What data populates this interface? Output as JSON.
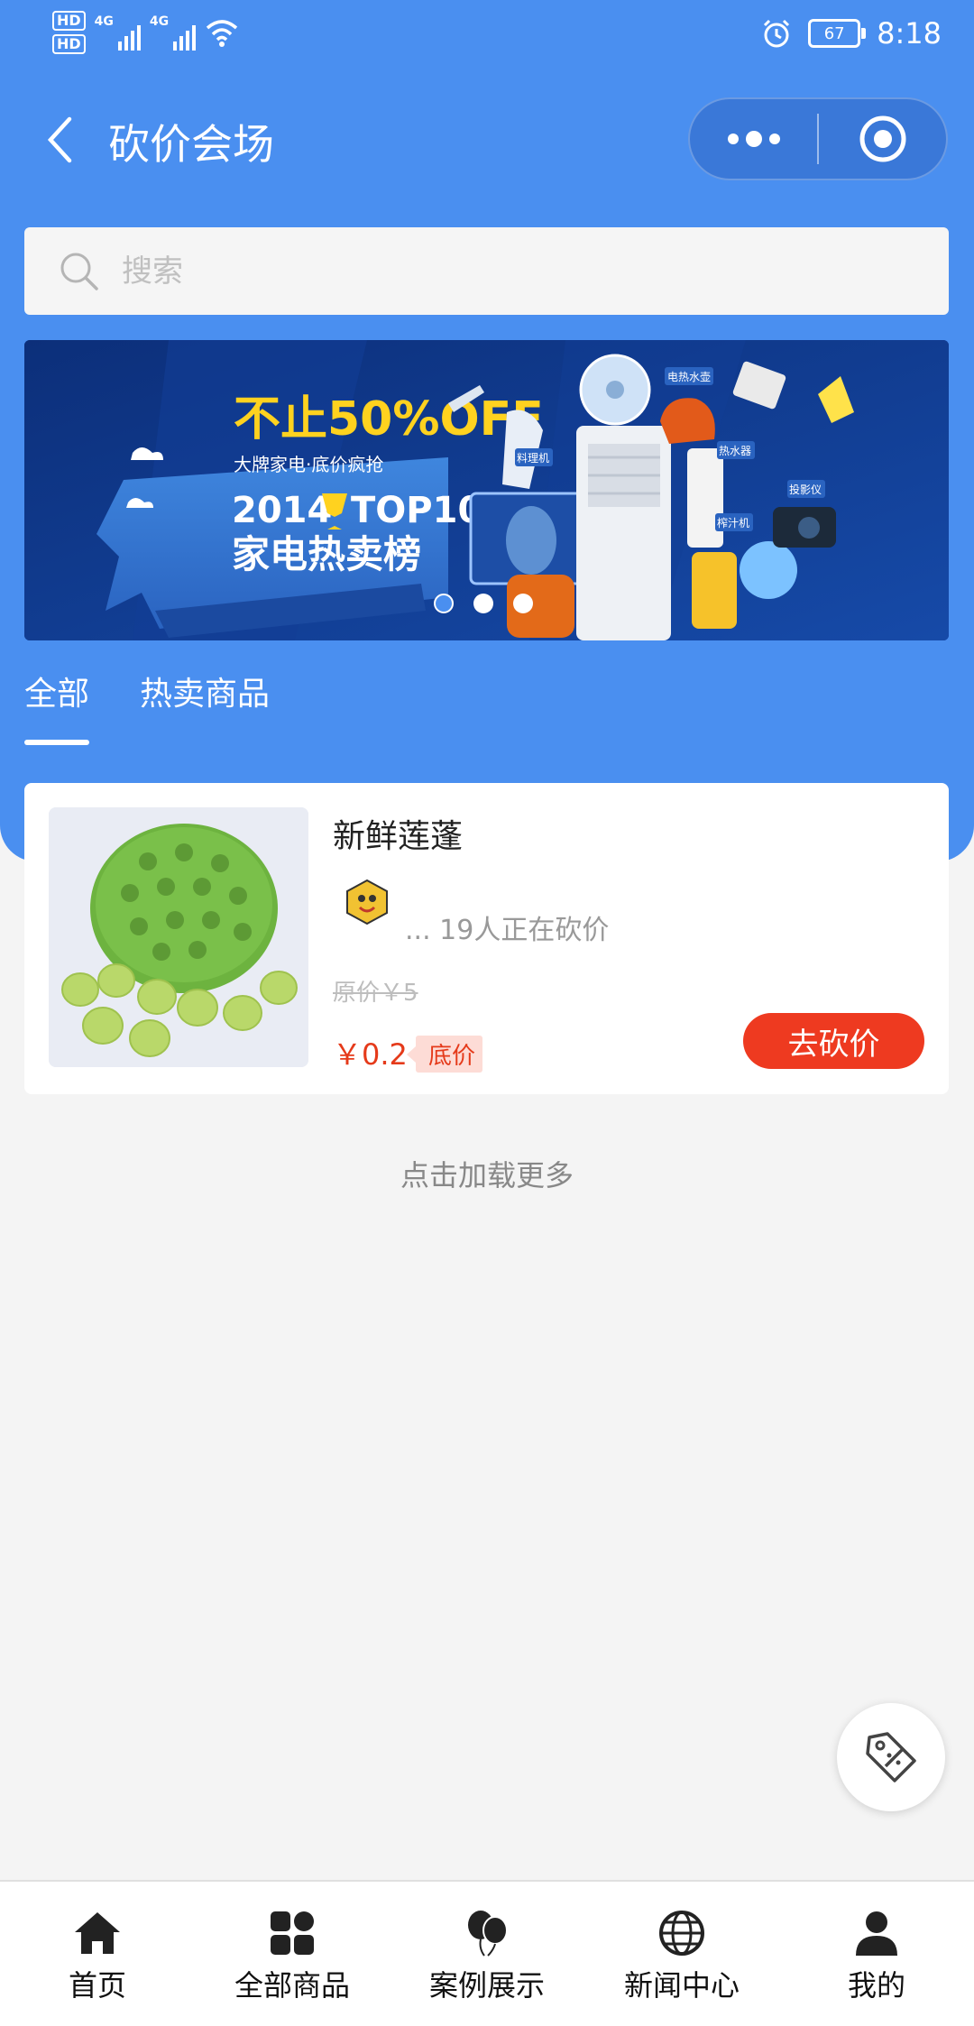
{
  "status_bar": {
    "hd1": "HD",
    "hd2": "HD",
    "net1": "4G",
    "net2": "4G",
    "battery": "67",
    "time": "8:18"
  },
  "navbar": {
    "title": "砍价会场"
  },
  "search": {
    "placeholder": "搜索"
  },
  "banner": {
    "headline": "不止50%OFF",
    "subline": "大牌家电·底价疯抢",
    "year": "2014",
    "top": "TOP10",
    "caption": "家电热卖榜",
    "labels": [
      "电热水壶",
      "料理机",
      "热水器",
      "投影仪",
      "榨汁机"
    ],
    "slide_count": 3,
    "active_slide": 1
  },
  "tabs": [
    {
      "label": "全部",
      "active": true
    },
    {
      "label": "热卖商品",
      "active": false
    }
  ],
  "product": {
    "name": "新鲜莲蓬",
    "bargain_text": "... 19人正在砍价",
    "original_price": "原价￥5",
    "price": "￥0.2",
    "floor_label": "底价",
    "button": "去砍价"
  },
  "load_more": "点击加载更多",
  "tabbar": [
    {
      "label": "首页",
      "icon": "home-icon"
    },
    {
      "label": "全部商品",
      "icon": "grid-icon"
    },
    {
      "label": "案例展示",
      "icon": "balloons-icon"
    },
    {
      "label": "新闻中心",
      "icon": "globe-icon"
    },
    {
      "label": "我的",
      "icon": "user-icon"
    }
  ],
  "colors": {
    "header_blue": "#4a8ff0",
    "price_red": "#e53a1a",
    "button_red": "#ee3a20"
  }
}
